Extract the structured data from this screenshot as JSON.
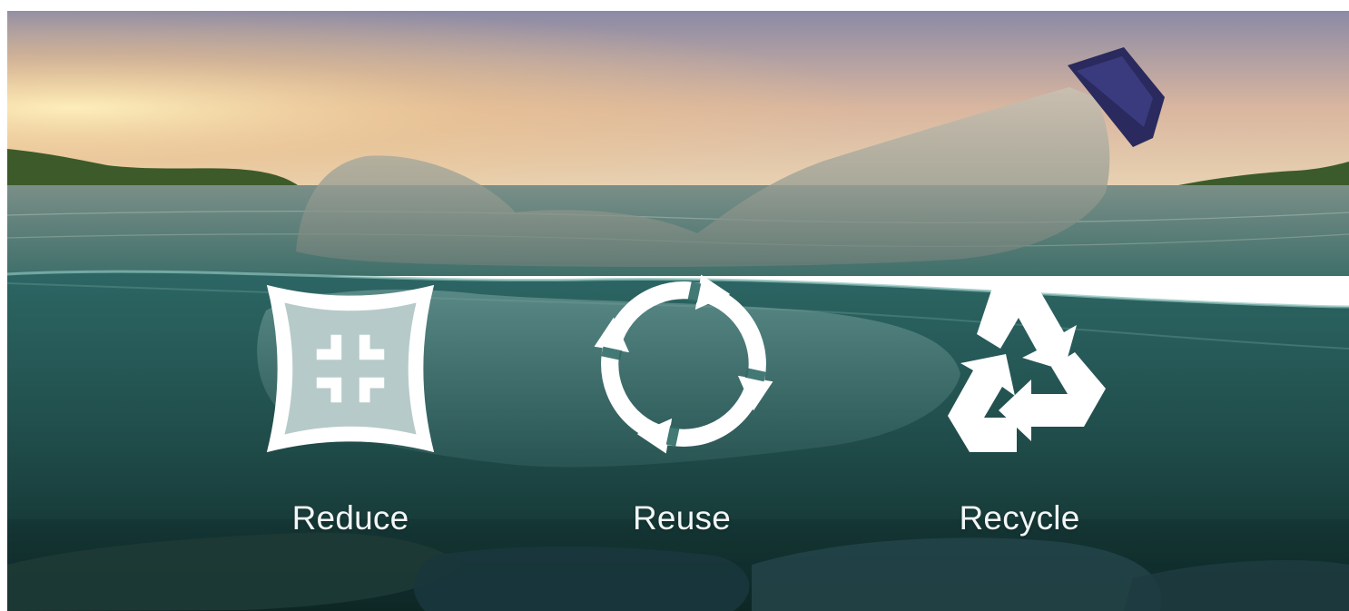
{
  "labels": {
    "reduce": "Reduce",
    "reuse": "Reuse",
    "recycle": "Recycle"
  },
  "icons": {
    "reduce": "compress-arrows-icon",
    "reuse": "circular-arrows-icon",
    "recycle": "recycle-icon"
  },
  "colors": {
    "icon_fill": "#ffffff",
    "label_text": "#f2f6f6",
    "sky_top": "#8e8aa8",
    "sky_glow": "#f6cf8a",
    "water_surface": "#2f6f6e",
    "underwater": "#1f4f4d",
    "deep_water": "#0d2422"
  }
}
